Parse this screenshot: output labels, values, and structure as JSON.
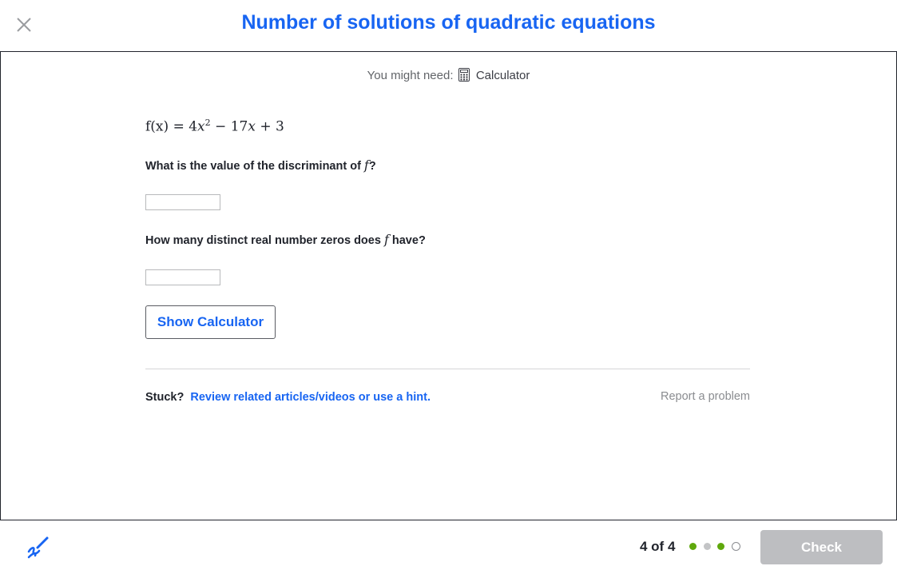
{
  "header": {
    "title": "Number of solutions of quadratic equations",
    "close_icon": "close-icon"
  },
  "toolbar_hint": {
    "prefix": "You might need:",
    "tool_icon": "calculator-icon",
    "tool_label": "Calculator"
  },
  "problem": {
    "equation": {
      "lhs": "f(x)",
      "eq": "=",
      "coef_a": "4",
      "var": "x",
      "exponent": "2",
      "minus": "−",
      "coef_b": "17",
      "plus": "+",
      "const": "3"
    },
    "question1": {
      "text_before": "What is the value of the discriminant of ",
      "var": "f",
      "text_after": "?",
      "answer_value": ""
    },
    "question2": {
      "text_before": "How many distinct real number zeros does ",
      "var": "f",
      "text_after": " have?",
      "answer_value": ""
    },
    "show_calculator_label": "Show Calculator"
  },
  "help": {
    "stuck_label": "Stuck?",
    "hint_link": "Review related articles/videos or use a hint.",
    "report_label": "Report a problem"
  },
  "footer": {
    "scratchpad_icon": "scratchpad-pencil-icon",
    "progress_text": "4 of 4",
    "progress_dots": [
      "correct",
      "neutral",
      "correct",
      "current"
    ],
    "check_label": "Check",
    "colors": {
      "correct": "#5fa80c",
      "neutral": "#c3c4c6",
      "accent": "#1865f2",
      "check_disabled": "#bdbec1"
    }
  }
}
